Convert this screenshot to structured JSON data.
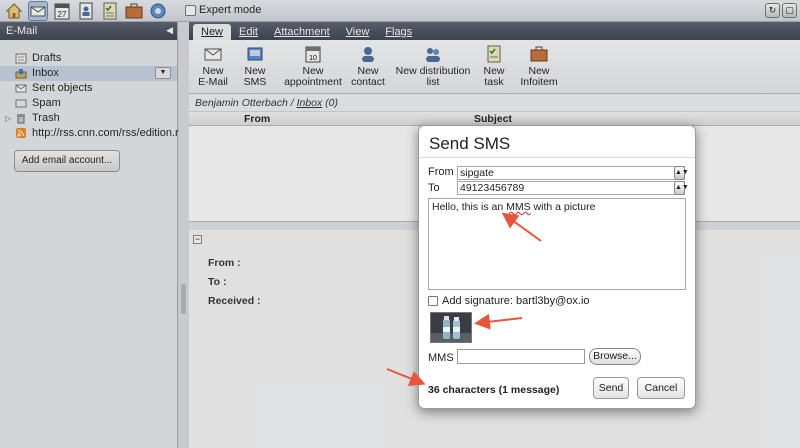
{
  "topbar": {
    "expert_mode_label": "Expert mode",
    "icons": [
      "home-icon",
      "mail-icon",
      "calendar-icon",
      "contacts-icon",
      "tasks-icon",
      "infostore-icon",
      "settings-icon"
    ]
  },
  "sidebar": {
    "header": "E-Mail",
    "items": [
      {
        "label": "Drafts",
        "icon": "drafts-icon"
      },
      {
        "label": "Inbox",
        "icon": "inbox-icon",
        "selected": true
      },
      {
        "label": "Sent objects",
        "icon": "sent-icon"
      },
      {
        "label": "Spam",
        "icon": "spam-icon"
      },
      {
        "label": "Trash",
        "icon": "trash-icon"
      },
      {
        "label": "http://rss.cnn.com/rss/edition.rss",
        "icon": "rss-icon"
      }
    ],
    "add_account_label": "Add email account..."
  },
  "main": {
    "tabs": [
      {
        "label": "New",
        "active": true
      },
      {
        "label": "Edit"
      },
      {
        "label": "Attachment"
      },
      {
        "label": "View"
      },
      {
        "label": "Flags"
      }
    ],
    "ribbon": [
      {
        "line1": "New",
        "line2": "E-Mail",
        "icon": "new-email-icon"
      },
      {
        "line1": "New",
        "line2": "SMS",
        "icon": "new-sms-icon"
      },
      {
        "line1": "New",
        "line2": "appointment",
        "icon": "new-appointment-icon"
      },
      {
        "line1": "New",
        "line2": "contact",
        "icon": "new-contact-icon"
      },
      {
        "line1": "New distribution",
        "line2": "list",
        "icon": "new-distribution-list-icon"
      },
      {
        "line1": "New",
        "line2": "task",
        "icon": "new-task-icon"
      },
      {
        "line1": "New",
        "line2": "Infoitem",
        "icon": "new-infoitem-icon"
      }
    ],
    "breadcrumb": {
      "user": "Benjamin Otterbach",
      "sep": " / ",
      "folder": "Inbox",
      "count": " (0)"
    },
    "columns": {
      "from": "From",
      "subject": "Subject"
    },
    "preview": {
      "from": "From :",
      "to": "To :",
      "received": "Received :"
    }
  },
  "dialog": {
    "title": "Send SMS",
    "from_label": "From",
    "from_value": "sipgate",
    "to_label": "To",
    "to_value": "49123456789",
    "message_pre": "Hello, this is an ",
    "message_mms": "MMS",
    "message_post": " with a picture",
    "signature_label": "Add signature: bartl3by@ox.io",
    "mms_label": "MMS",
    "browse_label": "Browse...",
    "char_count": "36 characters (1 message)",
    "send_label": "Send",
    "cancel_label": "Cancel"
  },
  "colors": {
    "arrow": "#e8553d",
    "header_dark": "#4a515d",
    "selected_row": "#c8d5e6"
  }
}
